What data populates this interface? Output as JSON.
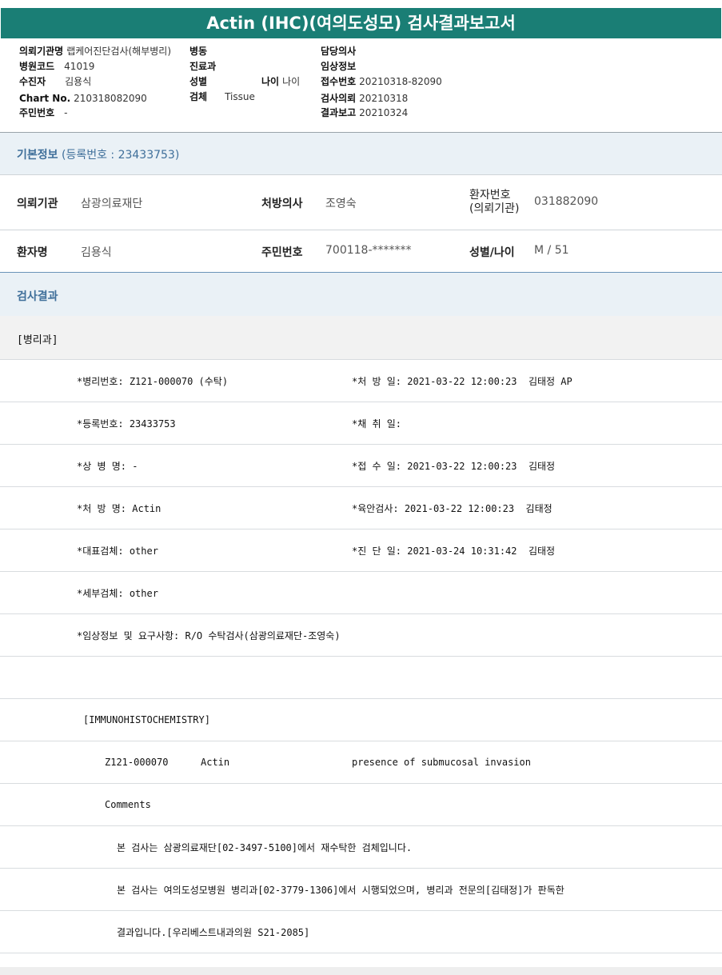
{
  "title": "Actin (IHC)(여의도성모) 검사결과보고서",
  "header": {
    "request_org_label": "의뢰기관명",
    "request_org_value": "랩케어진단검사(해부병리)",
    "ward_label": "병동",
    "doctor_label": "담당의사",
    "hospital_code_label": "병원코드",
    "hospital_code_value": "41019",
    "dept_label": "진료과",
    "clinical_info_label": "임상정보",
    "examinee_label": "수진자",
    "examinee_value": "김용식",
    "sex_label": "성별",
    "age_label": "나이",
    "age_value": "나이",
    "receipt_no_label": "접수번호",
    "receipt_no_value": "20210318-82090",
    "chart_no_label": "Chart No.",
    "chart_no_value": "210318082090",
    "specimen_label": "검체",
    "specimen_value": "Tissue",
    "test_request_label": "검사의뢰",
    "test_request_value": "20210318",
    "resident_no_label": "주민번호",
    "resident_no_value": "-",
    "result_report_label": "결과보고",
    "result_report_value": "20210324"
  },
  "basic_info": {
    "heading": "기본정보",
    "reg_no": "(등록번호 : 23433753)",
    "org_label": "의뢰기관",
    "org_value": "삼광의료재단",
    "doctor_label": "처방의사",
    "doctor_value": "조영숙",
    "patient_no_label_1": "환자번호",
    "patient_no_label_2": "(의뢰기관)",
    "patient_no_value": "031882090",
    "name_label": "환자명",
    "name_value": "김용식",
    "resident_label": "주민번호",
    "resident_value": "700118-*******",
    "sex_age_label": "성별/나이",
    "sex_age_value": "M / 51"
  },
  "results": {
    "heading": "검사결과",
    "dept": "[병리과]",
    "rows": [
      {
        "left": "*병리번호: Z121-000070 (수탁)",
        "right": "*처 방 일: 2021-03-22 12:00:23  김태정 AP"
      },
      {
        "left": "*등록번호: 23433753",
        "right": "*채 취 일:"
      },
      {
        "left": "*상 병 명: -",
        "right": "*접 수 일: 2021-03-22 12:00:23  김태정"
      },
      {
        "left": "*처 방 명: Actin",
        "right": "*육안검사: 2021-03-22 12:00:23  김태정"
      },
      {
        "left": "*대표검체: other",
        "right": "*진 단 일: 2021-03-24 10:31:42  김태정"
      },
      {
        "left": "*세부검체: other",
        "right": ""
      },
      {
        "left": "*임상정보 및 요구사항: R/O 수탁검사(삼광의료재단-조영숙)",
        "right": ""
      }
    ],
    "ihc_heading": "[IMMUNOHISTOCHEMISTRY]",
    "ihc_no": "Z121-000070",
    "ihc_test": "Actin",
    "ihc_result": "presence of submucosal invasion",
    "comments_label": "Comments",
    "comment_1": "본 검사는 삼광의료재단[02-3497-5100]에서 재수탁한 검체입니다.",
    "comment_2": "본 검사는 여의도성모병원 병리과[02-3779-1306]에서 시행되었으며, 병리과 전문의[김태정]가 판독한",
    "comment_3": "결과입니다.[우리베스트내과의원 S21-2085]"
  }
}
